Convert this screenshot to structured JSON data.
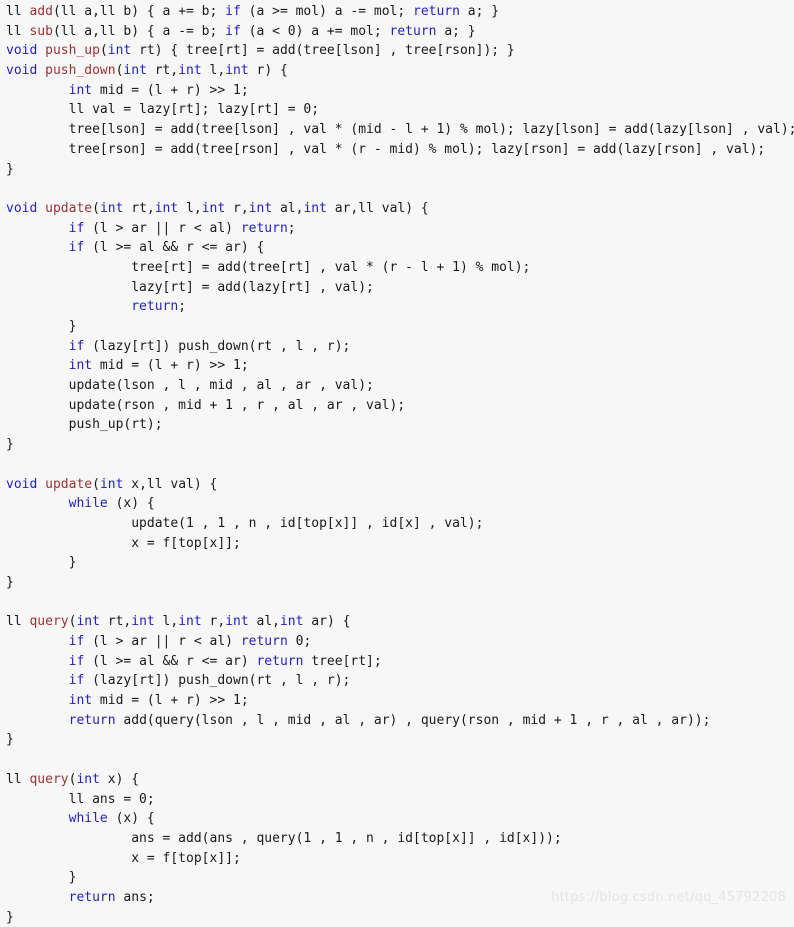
{
  "editor": {
    "background_color": "#f7f7f7",
    "plain_color": "#1a1a1a",
    "keyword_color": "#2121cc",
    "function_color": "#9b3232",
    "language": "C++"
  },
  "watermark": {
    "text": "https://blog.csdn.net/qq_45792208",
    "color": "#e4e4e4"
  },
  "code": {
    "lines": [
      [
        {
          "t": "ll ",
          "c": "pln"
        },
        {
          "t": "add",
          "c": "fn"
        },
        {
          "t": "(ll a,ll b) { a += b; ",
          "c": "pln"
        },
        {
          "t": "if",
          "c": "kw"
        },
        {
          "t": " (a >= mol) a -= mol; ",
          "c": "pln"
        },
        {
          "t": "return",
          "c": "kw"
        },
        {
          "t": " a; }",
          "c": "pln"
        }
      ],
      [
        {
          "t": "ll ",
          "c": "pln"
        },
        {
          "t": "sub",
          "c": "fn"
        },
        {
          "t": "(ll a,ll b) { a -= b; ",
          "c": "pln"
        },
        {
          "t": "if",
          "c": "kw"
        },
        {
          "t": " (a < 0) a += mol; ",
          "c": "pln"
        },
        {
          "t": "return",
          "c": "kw"
        },
        {
          "t": " a; }",
          "c": "pln"
        }
      ],
      [
        {
          "t": "void",
          "c": "kw"
        },
        {
          "t": " ",
          "c": "pln"
        },
        {
          "t": "push_up",
          "c": "fn"
        },
        {
          "t": "(",
          "c": "pln"
        },
        {
          "t": "int",
          "c": "kw"
        },
        {
          "t": " rt) { tree[rt] = add(tree[lson] , tree[rson]); }",
          "c": "pln"
        }
      ],
      [
        {
          "t": "void",
          "c": "kw"
        },
        {
          "t": " ",
          "c": "pln"
        },
        {
          "t": "push_down",
          "c": "fn"
        },
        {
          "t": "(",
          "c": "pln"
        },
        {
          "t": "int",
          "c": "kw"
        },
        {
          "t": " rt,",
          "c": "pln"
        },
        {
          "t": "int",
          "c": "kw"
        },
        {
          "t": " l,",
          "c": "pln"
        },
        {
          "t": "int",
          "c": "kw"
        },
        {
          "t": " r) {",
          "c": "pln"
        }
      ],
      [
        {
          "t": "        ",
          "c": "pln"
        },
        {
          "t": "int",
          "c": "kw"
        },
        {
          "t": " mid = (l + r) >> 1;",
          "c": "pln"
        }
      ],
      [
        {
          "t": "        ll val = lazy[rt]; lazy[rt] = 0;",
          "c": "pln"
        }
      ],
      [
        {
          "t": "        tree[lson] = add(tree[lson] , val * (mid - l + 1) % mol); lazy[lson] = add(lazy[lson] , val);",
          "c": "pln"
        }
      ],
      [
        {
          "t": "        tree[rson] = add(tree[rson] , val * (r - mid) % mol); lazy[rson] = add(lazy[rson] , val);",
          "c": "pln"
        }
      ],
      [
        {
          "t": "}",
          "c": "pln"
        }
      ],
      [],
      [
        {
          "t": "void",
          "c": "kw"
        },
        {
          "t": " ",
          "c": "pln"
        },
        {
          "t": "update",
          "c": "fn"
        },
        {
          "t": "(",
          "c": "pln"
        },
        {
          "t": "int",
          "c": "kw"
        },
        {
          "t": " rt,",
          "c": "pln"
        },
        {
          "t": "int",
          "c": "kw"
        },
        {
          "t": " l,",
          "c": "pln"
        },
        {
          "t": "int",
          "c": "kw"
        },
        {
          "t": " r,",
          "c": "pln"
        },
        {
          "t": "int",
          "c": "kw"
        },
        {
          "t": " al,",
          "c": "pln"
        },
        {
          "t": "int",
          "c": "kw"
        },
        {
          "t": " ar,ll val) {",
          "c": "pln"
        }
      ],
      [
        {
          "t": "        ",
          "c": "pln"
        },
        {
          "t": "if",
          "c": "kw"
        },
        {
          "t": " (l > ar || r < al) ",
          "c": "pln"
        },
        {
          "t": "return",
          "c": "kw"
        },
        {
          "t": ";",
          "c": "pln"
        }
      ],
      [
        {
          "t": "        ",
          "c": "pln"
        },
        {
          "t": "if",
          "c": "kw"
        },
        {
          "t": " (l >= al && r <= ar) {",
          "c": "pln"
        }
      ],
      [
        {
          "t": "                tree[rt] = add(tree[rt] , val * (r - l + 1) % mol);",
          "c": "pln"
        }
      ],
      [
        {
          "t": "                lazy[rt] = add(lazy[rt] , val);",
          "c": "pln"
        }
      ],
      [
        {
          "t": "                ",
          "c": "pln"
        },
        {
          "t": "return",
          "c": "kw"
        },
        {
          "t": ";",
          "c": "pln"
        }
      ],
      [
        {
          "t": "        }",
          "c": "pln"
        }
      ],
      [
        {
          "t": "        ",
          "c": "pln"
        },
        {
          "t": "if",
          "c": "kw"
        },
        {
          "t": " (lazy[rt]) push_down(rt , l , r);",
          "c": "pln"
        }
      ],
      [
        {
          "t": "        ",
          "c": "pln"
        },
        {
          "t": "int",
          "c": "kw"
        },
        {
          "t": " mid = (l + r) >> 1;",
          "c": "pln"
        }
      ],
      [
        {
          "t": "        update(lson , l , mid , al , ar , val);",
          "c": "pln"
        }
      ],
      [
        {
          "t": "        update(rson , mid + 1 , r , al , ar , val);",
          "c": "pln"
        }
      ],
      [
        {
          "t": "        push_up(rt);",
          "c": "pln"
        }
      ],
      [
        {
          "t": "}",
          "c": "pln"
        }
      ],
      [],
      [
        {
          "t": "void",
          "c": "kw"
        },
        {
          "t": " ",
          "c": "pln"
        },
        {
          "t": "update",
          "c": "fn"
        },
        {
          "t": "(",
          "c": "pln"
        },
        {
          "t": "int",
          "c": "kw"
        },
        {
          "t": " x,ll val) {",
          "c": "pln"
        }
      ],
      [
        {
          "t": "        ",
          "c": "pln"
        },
        {
          "t": "while",
          "c": "kw"
        },
        {
          "t": " (x) {",
          "c": "pln"
        }
      ],
      [
        {
          "t": "                update(1 , 1 , n , id[top[x]] , id[x] , val);",
          "c": "pln"
        }
      ],
      [
        {
          "t": "                x = f[top[x]];",
          "c": "pln"
        }
      ],
      [
        {
          "t": "        }",
          "c": "pln"
        }
      ],
      [
        {
          "t": "}",
          "c": "pln"
        }
      ],
      [],
      [
        {
          "t": "ll ",
          "c": "pln"
        },
        {
          "t": "query",
          "c": "fn"
        },
        {
          "t": "(",
          "c": "pln"
        },
        {
          "t": "int",
          "c": "kw"
        },
        {
          "t": " rt,",
          "c": "pln"
        },
        {
          "t": "int",
          "c": "kw"
        },
        {
          "t": " l,",
          "c": "pln"
        },
        {
          "t": "int",
          "c": "kw"
        },
        {
          "t": " r,",
          "c": "pln"
        },
        {
          "t": "int",
          "c": "kw"
        },
        {
          "t": " al,",
          "c": "pln"
        },
        {
          "t": "int",
          "c": "kw"
        },
        {
          "t": " ar) {",
          "c": "pln"
        }
      ],
      [
        {
          "t": "        ",
          "c": "pln"
        },
        {
          "t": "if",
          "c": "kw"
        },
        {
          "t": " (l > ar || r < al) ",
          "c": "pln"
        },
        {
          "t": "return",
          "c": "kw"
        },
        {
          "t": " 0;",
          "c": "pln"
        }
      ],
      [
        {
          "t": "        ",
          "c": "pln"
        },
        {
          "t": "if",
          "c": "kw"
        },
        {
          "t": " (l >= al && r <= ar) ",
          "c": "pln"
        },
        {
          "t": "return",
          "c": "kw"
        },
        {
          "t": " tree[rt];",
          "c": "pln"
        }
      ],
      [
        {
          "t": "        ",
          "c": "pln"
        },
        {
          "t": "if",
          "c": "kw"
        },
        {
          "t": " (lazy[rt]) push_down(rt , l , r);",
          "c": "pln"
        }
      ],
      [
        {
          "t": "        ",
          "c": "pln"
        },
        {
          "t": "int",
          "c": "kw"
        },
        {
          "t": " mid = (l + r) >> 1;",
          "c": "pln"
        }
      ],
      [
        {
          "t": "        ",
          "c": "pln"
        },
        {
          "t": "return",
          "c": "kw"
        },
        {
          "t": " add(query(lson , l , mid , al , ar) , query(rson , mid + 1 , r , al , ar));",
          "c": "pln"
        }
      ],
      [
        {
          "t": "}",
          "c": "pln"
        }
      ],
      [],
      [
        {
          "t": "ll ",
          "c": "pln"
        },
        {
          "t": "query",
          "c": "fn"
        },
        {
          "t": "(",
          "c": "pln"
        },
        {
          "t": "int",
          "c": "kw"
        },
        {
          "t": " x) {",
          "c": "pln"
        }
      ],
      [
        {
          "t": "        ll ans = 0;",
          "c": "pln"
        }
      ],
      [
        {
          "t": "        ",
          "c": "pln"
        },
        {
          "t": "while",
          "c": "kw"
        },
        {
          "t": " (x) {",
          "c": "pln"
        }
      ],
      [
        {
          "t": "                ans = add(ans , query(1 , 1 , n , id[top[x]] , id[x]));",
          "c": "pln"
        }
      ],
      [
        {
          "t": "                x = f[top[x]];",
          "c": "pln"
        }
      ],
      [
        {
          "t": "        }",
          "c": "pln"
        }
      ],
      [
        {
          "t": "        ",
          "c": "pln"
        },
        {
          "t": "return",
          "c": "kw"
        },
        {
          "t": " ans;",
          "c": "pln"
        }
      ],
      [
        {
          "t": "}",
          "c": "pln"
        }
      ]
    ]
  }
}
